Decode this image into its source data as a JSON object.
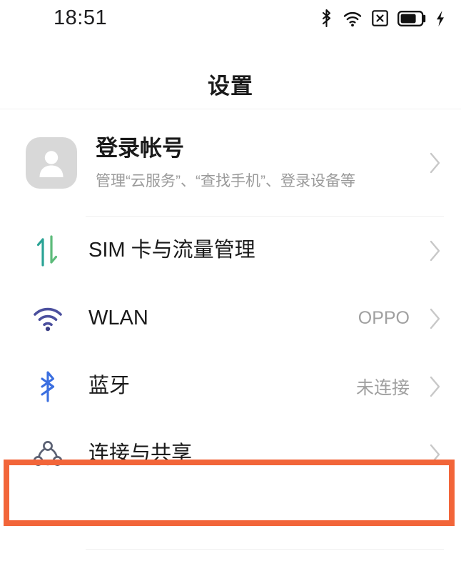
{
  "statusbar": {
    "time": "18:51",
    "icons": [
      {
        "name": "bluetooth-icon",
        "label": "bluetooth"
      },
      {
        "name": "wifi-icon",
        "label": "wifi"
      },
      {
        "name": "no-sim-icon",
        "label": "no-signal"
      },
      {
        "name": "battery-icon",
        "label": "battery"
      },
      {
        "name": "charging-bolt-icon",
        "label": "charging"
      }
    ]
  },
  "header": {
    "title": "设置"
  },
  "colors": {
    "highlight": "#f26539",
    "sim_icon_up": "#2aa395",
    "sim_icon_down": "#5cbb7a",
    "wifi_icon": "#4b4f9e",
    "bluetooth_icon": "#3b6fe0",
    "share_icon": "#5b6173",
    "value_text": "#a0a0a0",
    "label_text": "#1a1a1a"
  },
  "list": {
    "account": {
      "name": "account-row",
      "label": "登录帐号",
      "sub": "管理“云服务”、“查找手机”、登录设备等",
      "avatar": "person-avatar-icon",
      "chevron": "chevron-right-icon"
    },
    "items": [
      {
        "name": "sim-data-row",
        "icon": "sim-transfer-icon",
        "label": "SIM 卡与流量管理",
        "value": "",
        "chevron": "chevron-right-icon",
        "highlighted": false
      },
      {
        "name": "wlan-row",
        "icon": "wifi-icon",
        "label": "WLAN",
        "value": "OPPO",
        "chevron": "chevron-right-icon",
        "highlighted": false
      },
      {
        "name": "bluetooth-row",
        "icon": "bluetooth-icon",
        "label": "蓝牙",
        "value": "未连接",
        "chevron": "chevron-right-icon",
        "highlighted": false
      },
      {
        "name": "connection-sharing-row",
        "icon": "connection-share-icon",
        "label": "连接与共享",
        "value": "",
        "chevron": "chevron-right-icon",
        "highlighted": true
      }
    ]
  }
}
